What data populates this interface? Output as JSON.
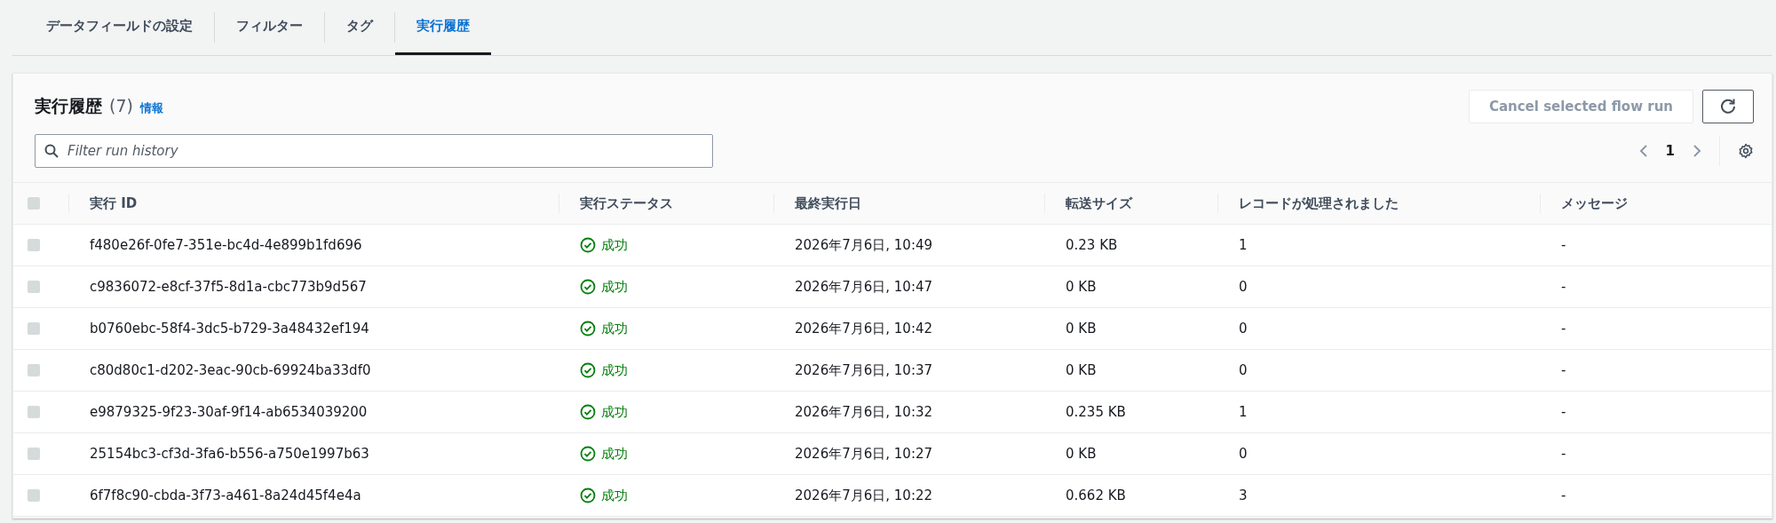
{
  "tabs": [
    {
      "label": "データフィールドの設定",
      "selected": false
    },
    {
      "label": "フィルター",
      "selected": false
    },
    {
      "label": "タグ",
      "selected": false
    },
    {
      "label": "実行履歴",
      "selected": true
    }
  ],
  "panel": {
    "title": "実行履歴",
    "count": "(7)",
    "info_link": "情報",
    "cancel_button": {
      "label": "Cancel selected flow run",
      "disabled": true
    },
    "search": {
      "placeholder": "Filter run history"
    },
    "pagination": {
      "page": "1"
    }
  },
  "table": {
    "select_all": {
      "checked": false
    },
    "columns": [
      "実行 ID",
      "実行ステータス",
      "最終実行日",
      "転送サイズ",
      "レコードが処理されました",
      "メッセージ"
    ],
    "rows": [
      {
        "checked": false,
        "id": "f480e26f-0fe7-351e-bc4d-4e899b1fd696",
        "status": {
          "kind": "success",
          "label": "成功"
        },
        "date": "2026年7月6日, 10:49",
        "size": "0.23 KB",
        "records": "1",
        "message": "-"
      },
      {
        "checked": false,
        "id": "c9836072-e8cf-37f5-8d1a-cbc773b9d567",
        "status": {
          "kind": "success",
          "label": "成功"
        },
        "date": "2026年7月6日, 10:47",
        "size": "0 KB",
        "records": "0",
        "message": "-"
      },
      {
        "checked": false,
        "id": "b0760ebc-58f4-3dc5-b729-3a48432ef194",
        "status": {
          "kind": "success",
          "label": "成功"
        },
        "date": "2026年7月6日, 10:42",
        "size": "0 KB",
        "records": "0",
        "message": "-"
      },
      {
        "checked": false,
        "id": "c80d80c1-d202-3eac-90cb-69924ba33df0",
        "status": {
          "kind": "success",
          "label": "成功"
        },
        "date": "2026年7月6日, 10:37",
        "size": "0 KB",
        "records": "0",
        "message": "-"
      },
      {
        "checked": false,
        "id": "e9879325-9f23-30af-9f14-ab6534039200",
        "status": {
          "kind": "success",
          "label": "成功"
        },
        "date": "2026年7月6日, 10:32",
        "size": "0.235 KB",
        "records": "1",
        "message": "-"
      },
      {
        "checked": false,
        "id": "25154bc3-cf3d-3fa6-b556-a750e1997b63",
        "status": {
          "kind": "success",
          "label": "成功"
        },
        "date": "2026年7月6日, 10:27",
        "size": "0 KB",
        "records": "0",
        "message": "-"
      },
      {
        "checked": false,
        "id": "6f7f8c90-cbda-3f73-a461-8a24d45f4e4a",
        "status": {
          "kind": "success",
          "label": "成功"
        },
        "date": "2026年7月6日, 10:22",
        "size": "0.662 KB",
        "records": "3",
        "message": "-"
      }
    ]
  }
}
